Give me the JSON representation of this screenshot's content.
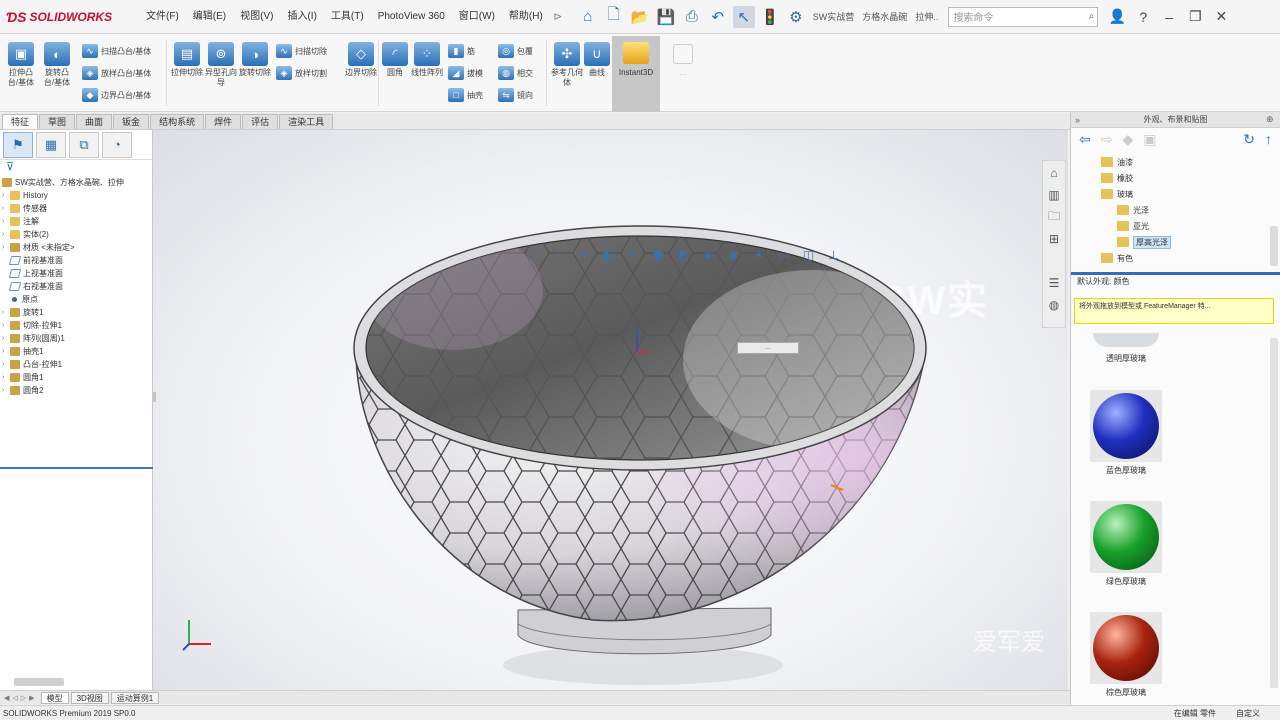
{
  "app": {
    "logo_text": "SOLIDWORKS"
  },
  "menu": {
    "items": [
      "文件(F)",
      "编辑(E)",
      "视图(V)",
      "插入(I)",
      "工具(T)",
      "PhotoView 360",
      "窗口(W)",
      "帮助(H)"
    ]
  },
  "toolbar": {
    "breadcrumb_1": "SW实战营",
    "breadcrumb_2": "方格水晶碗",
    "breadcrumb_3": "拉伸..",
    "search_placeholder": "搜索命令"
  },
  "ribbon": {
    "big_buttons": [
      {
        "label": "拉伸凸台/基体",
        "icon": "extrude-boss-icon"
      },
      {
        "label": "旋转凸台/基体",
        "icon": "revolve-boss-icon"
      },
      {
        "label": "拉伸切除",
        "icon": "extruded-cut-icon"
      },
      {
        "label": "异型孔向导",
        "icon": "hole-wizard-icon"
      },
      {
        "label": "旋转切除",
        "icon": "revolved-cut-icon"
      },
      {
        "label": "边界切除",
        "icon": "boundary-cut-icon"
      },
      {
        "label": "圆角",
        "icon": "fillet-icon"
      },
      {
        "label": "线性阵列",
        "icon": "linear-pattern-icon"
      },
      {
        "label": "参考几何体",
        "icon": "reference-geometry-icon"
      },
      {
        "label": "曲线",
        "icon": "curves-icon"
      }
    ],
    "small_buttons": [
      {
        "label": "扫描凸台/基体",
        "icon": "swept-boss-icon"
      },
      {
        "label": "放样凸台/基体",
        "icon": "lofted-boss-icon"
      },
      {
        "label": "边界凸台/基体",
        "icon": "boundary-boss-icon"
      },
      {
        "label": "扫描切除",
        "icon": "swept-cut-icon"
      },
      {
        "label": "放样切割",
        "icon": "lofted-cut-icon"
      },
      {
        "label": "筋",
        "icon": "rib-icon"
      },
      {
        "label": "拔模",
        "icon": "draft-icon"
      },
      {
        "label": "抽壳",
        "icon": "shell-icon"
      },
      {
        "label": "包覆",
        "icon": "wrap-icon"
      },
      {
        "label": "相交",
        "icon": "intersect-icon"
      },
      {
        "label": "镜向",
        "icon": "mirror-icon"
      }
    ],
    "instant3d_label": "Instant3D",
    "disabled_label": "..."
  },
  "cm_tabs": [
    "特征",
    "草图",
    "曲面",
    "钣金",
    "结构系统",
    "焊件",
    "评估",
    "渲染工具"
  ],
  "feature_tree": {
    "root": "SW实战营、方格水晶碗、拉伸",
    "items": [
      {
        "label": "History",
        "icon": "folder"
      },
      {
        "label": "传感器",
        "icon": "folder"
      },
      {
        "label": "注解",
        "icon": "folder"
      },
      {
        "label": "实体(2)",
        "icon": "folder"
      },
      {
        "label": "材质 <未指定>",
        "icon": "feat"
      },
      {
        "label": "前视基准面",
        "icon": "plane"
      },
      {
        "label": "上视基准面",
        "icon": "plane"
      },
      {
        "label": "右视基准面",
        "icon": "plane"
      },
      {
        "label": "原点",
        "icon": "point"
      },
      {
        "label": "旋转1",
        "icon": "feat"
      },
      {
        "label": "切除-拉伸1",
        "icon": "feat"
      },
      {
        "label": "阵列(圆周)1",
        "icon": "feat"
      },
      {
        "label": "抽壳1",
        "icon": "feat"
      },
      {
        "label": "凸台-拉伸1",
        "icon": "feat"
      },
      {
        "label": "圆角1",
        "icon": "feat"
      },
      {
        "label": "圆角2",
        "icon": "feat"
      }
    ]
  },
  "graphics": {
    "watermark_top": "SW实",
    "watermark_bottom": "爱军爱",
    "tag_label": "..."
  },
  "appearances": {
    "title": "外观、布景和贴图",
    "folders": [
      {
        "label": "油漆",
        "level": 1
      },
      {
        "label": "橡胶",
        "level": 1
      },
      {
        "label": "玻璃",
        "level": 1
      },
      {
        "label": "光泽",
        "level": 2
      },
      {
        "label": "亚光",
        "level": 2
      },
      {
        "label": "厚高光泽",
        "level": 2,
        "selected": true
      },
      {
        "label": "有色",
        "level": 1
      }
    ],
    "bottom_label": "默认外观: 颜色",
    "tooltip": "将外观拖放到模型或 FeatureManager 特...",
    "partial_swatch": "透明厚玻璃",
    "swatches": [
      {
        "label": "蓝色厚玻璃",
        "color": "#1f2fbf"
      },
      {
        "label": "绿色厚玻璃",
        "color": "#17a12b"
      },
      {
        "label": "棕色厚玻璃",
        "color": "#a8240f"
      }
    ]
  },
  "bottom_tabs": [
    "模型",
    "3D视图",
    "运动算例1"
  ],
  "status": {
    "left": "SOLIDWORKS Premium 2019 SP0.0",
    "mode": "在编辑 零件",
    "units": "自定义"
  }
}
